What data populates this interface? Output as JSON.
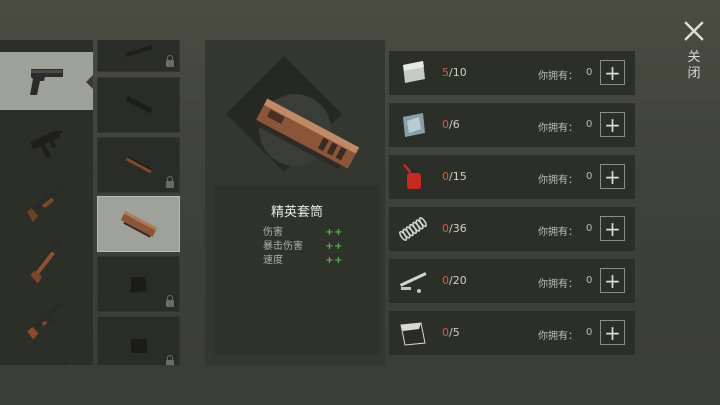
{
  "detail": {
    "part_name": "精英套筒",
    "stats": [
      {
        "label": "伤害",
        "value": "++"
      },
      {
        "label": "暴击伤害",
        "value": "++"
      },
      {
        "label": "速度",
        "value": "++"
      }
    ]
  },
  "weapons": [
    {
      "icon": "pistol-icon",
      "selected": true
    },
    {
      "icon": "uzi-icon",
      "selected": false
    },
    {
      "icon": "shotgun-icon",
      "selected": false
    },
    {
      "icon": "hunting-rifle-icon",
      "selected": false
    },
    {
      "icon": "ak47-icon",
      "selected": false
    },
    {
      "icon": "sniper-rifle-icon",
      "selected": false
    }
  ],
  "parts": [
    {
      "icon": "barrel-part-icon",
      "locked": true,
      "selected": false
    },
    {
      "icon": "suppressor-part-icon",
      "locked": true,
      "selected": false
    },
    {
      "icon": "copper-barrel-part-icon",
      "locked": true,
      "selected": false
    },
    {
      "icon": "slide-part-icon",
      "locked": false,
      "selected": true
    },
    {
      "icon": "magazine-part-icon",
      "locked": true,
      "selected": false
    },
    {
      "icon": "grip-part-icon",
      "locked": true,
      "selected": false
    }
  ],
  "materials": [
    {
      "icon": "metal-sheet-icon",
      "have": "5",
      "need": "/10",
      "own_label": "你拥有：",
      "own_value": "0"
    },
    {
      "icon": "steel-plate-icon",
      "have": "0",
      "need": "/6",
      "own_label": "你拥有：",
      "own_value": "0"
    },
    {
      "icon": "oil-can-icon",
      "have": "0",
      "need": "/15",
      "own_label": "你拥有：",
      "own_value": "0"
    },
    {
      "icon": "spring-icon",
      "have": "0",
      "need": "/36",
      "own_label": "你拥有：",
      "own_value": "0"
    },
    {
      "icon": "pins-icon",
      "have": "0",
      "need": "/20",
      "own_label": "你拥有：",
      "own_value": "0"
    },
    {
      "icon": "bent-plate-icon",
      "have": "0",
      "need": "/5",
      "own_label": "你拥有：",
      "own_value": "0"
    }
  ],
  "close_label": "关闭",
  "add_label": "+",
  "colors": {
    "shortage": "#e05444",
    "stat_plus": "#58b14d",
    "selected_bg": "#9ea19a"
  }
}
